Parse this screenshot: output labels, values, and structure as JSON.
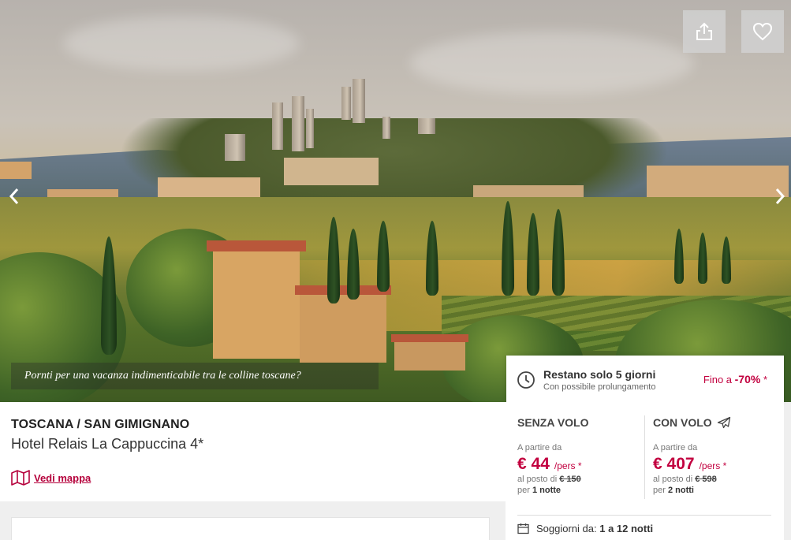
{
  "hero": {
    "caption": "Pornti per una vacanza indimenticabile tra le colline toscane?",
    "prev_icon": "chevron-left-icon",
    "next_icon": "chevron-right-icon",
    "share_icon": "share-icon",
    "favorite_icon": "heart-icon"
  },
  "info": {
    "region": "TOSCANA / SAN GIMIGNANO",
    "hotel": "Hotel Relais La Cappuccina 4*",
    "map_link": "Vedi mappa",
    "map_icon": "map-icon"
  },
  "countdown": {
    "title": "Restano solo 5 giorni",
    "subtitle": "Con possibile prolungamento",
    "discount_prefix": "Fino a ",
    "discount_value": "-70%",
    "discount_suffix": " *",
    "icon": "clock-icon"
  },
  "offers": {
    "no_flight": {
      "heading": "SENZA VOLO",
      "from_label": "A partire da",
      "price": "€ 44",
      "unit": "/pers *",
      "instead_label": "al posto di ",
      "old_price": "€ 150",
      "nights_label": "per ",
      "nights": "1 notte"
    },
    "with_flight": {
      "heading": "CON VOLO",
      "icon": "plane-icon",
      "from_label": "A partire da",
      "price": "€ 407",
      "unit": "/pers *",
      "instead_label": "al posto di ",
      "old_price": "€ 598",
      "nights_label": "per ",
      "nights": "2 notti"
    }
  },
  "stay": {
    "label": "Soggiorni da: ",
    "value": "1 a 12 notti",
    "icon": "calendar-icon"
  },
  "colors": {
    "accent": "#c2003f",
    "link": "#b5003b",
    "text": "#333333"
  }
}
